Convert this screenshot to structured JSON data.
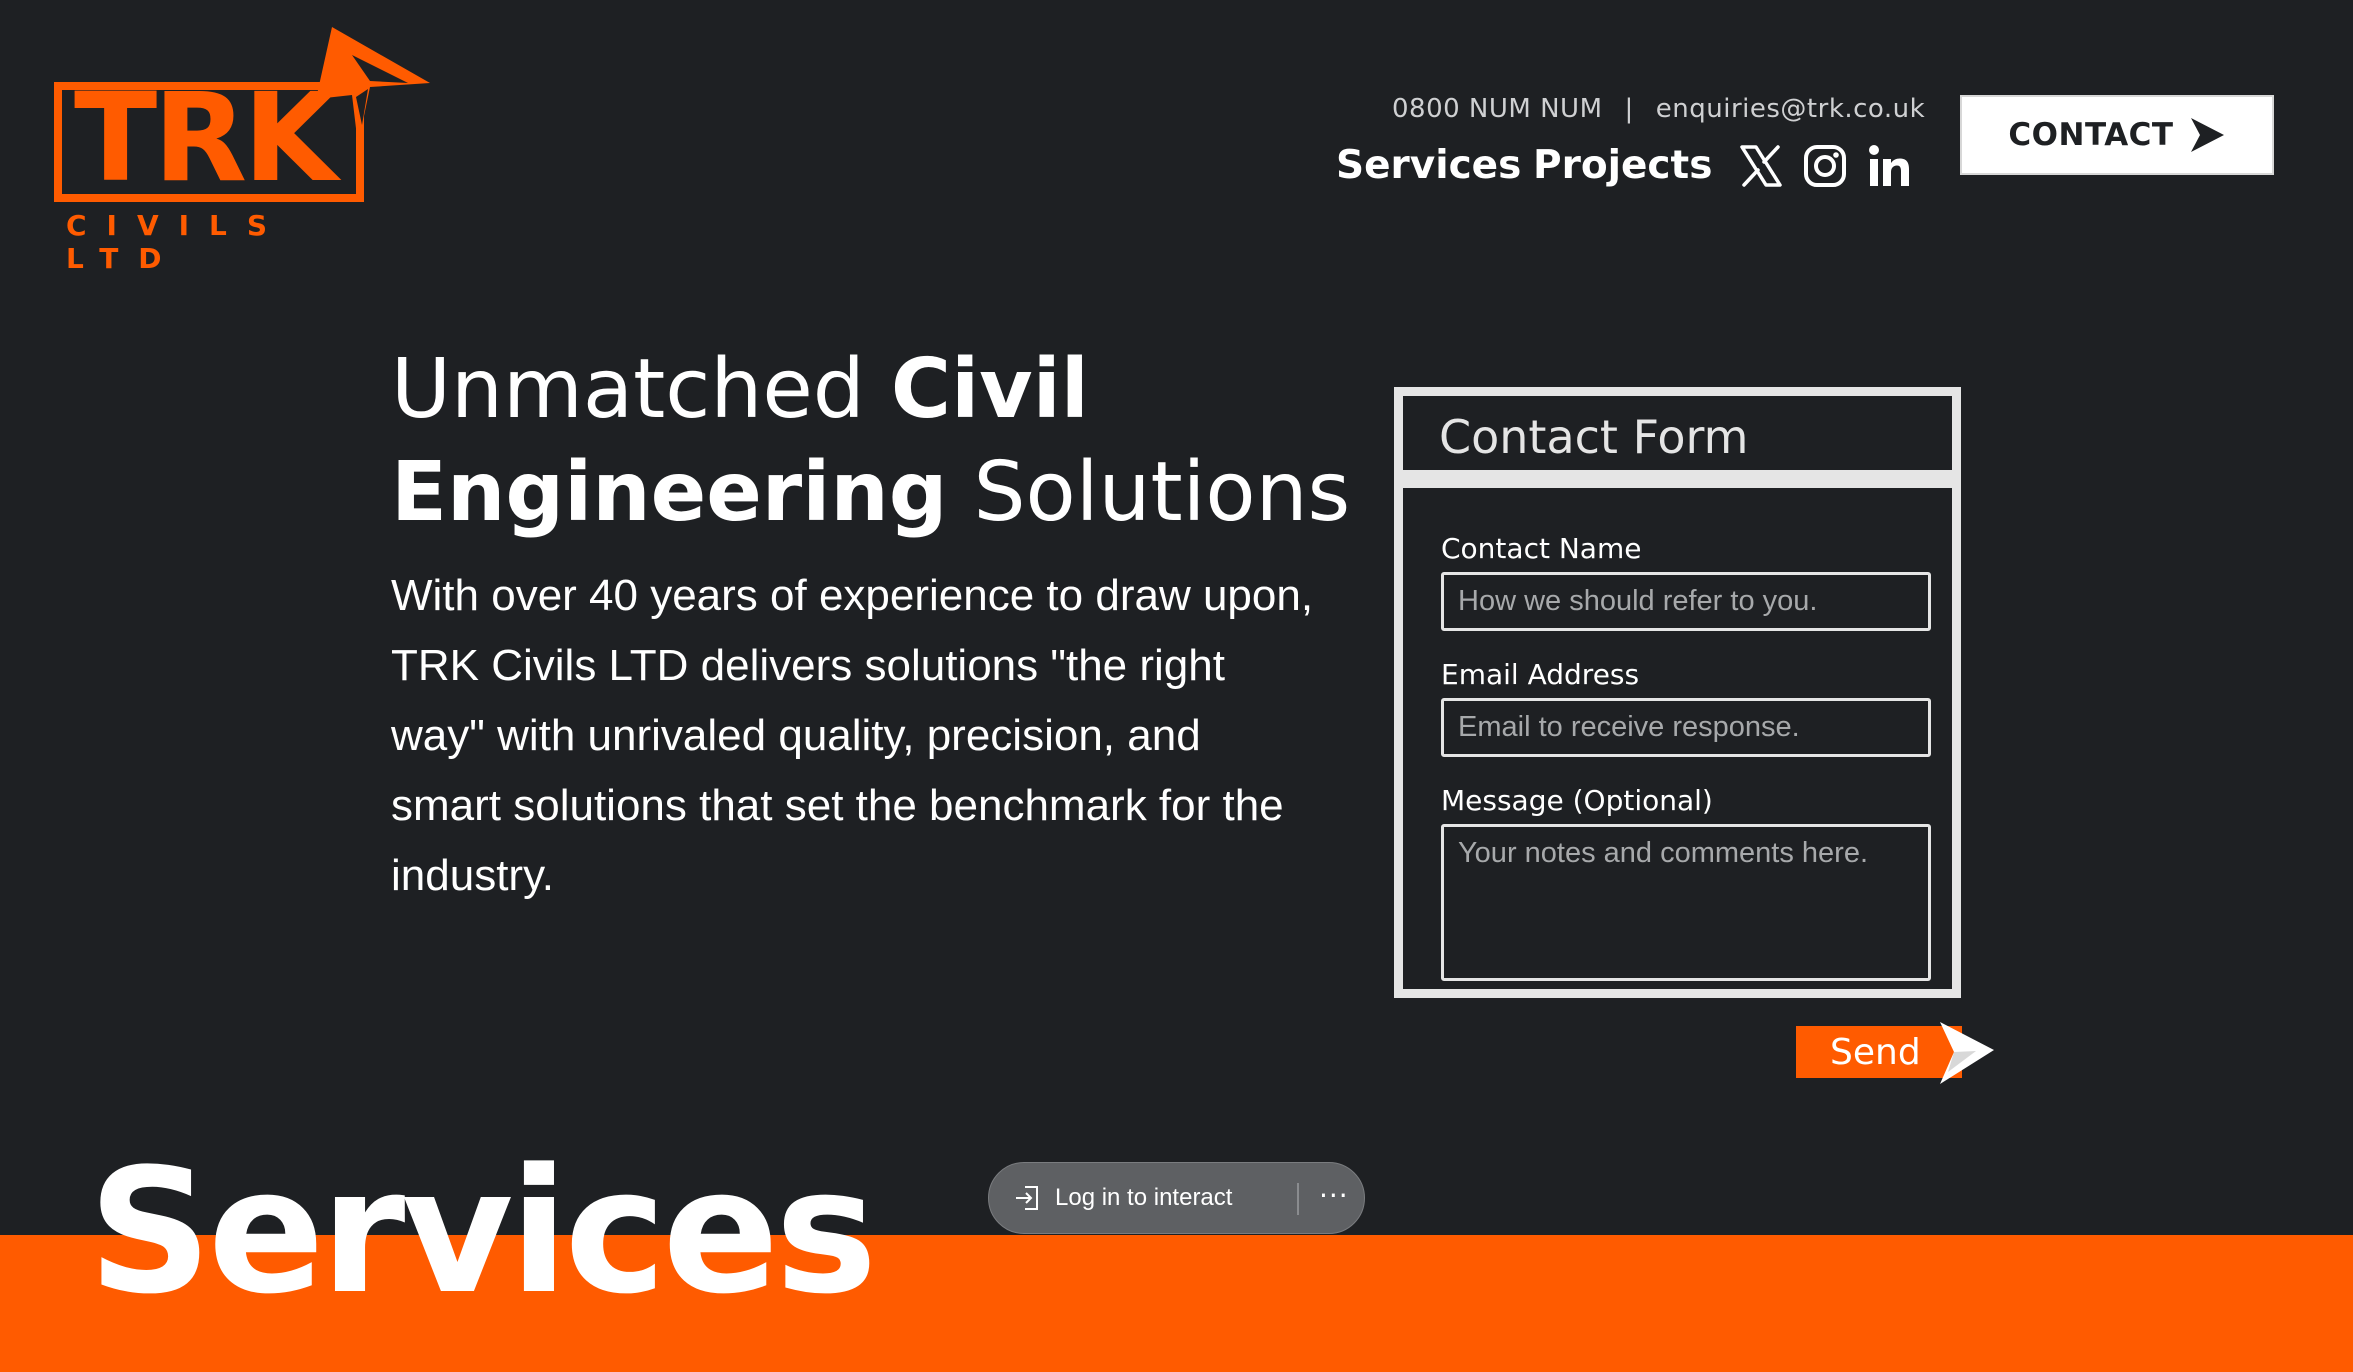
{
  "brand": {
    "logo_text": "TRK",
    "logo_subtitle": "CIVILS LTD",
    "accent_color": "#ff5b00",
    "background_color": "#1e2023"
  },
  "header": {
    "phone": "0800 NUM NUM",
    "separator": "|",
    "email": "enquiries@trk.co.uk",
    "nav": {
      "services": "Services",
      "projects": "Projects"
    },
    "social_icons": [
      "x-icon",
      "instagram-icon",
      "linkedin-icon"
    ],
    "contact_button": "CONTACT"
  },
  "hero": {
    "title_part1": "Unmatched ",
    "title_part2": "Civil",
    "title_part3": "Engineering",
    "title_part4": " Solutions",
    "body": "With over 40 years of experience to draw upon, TRK Civils LTD delivers solutions \"the right way\" with unrivaled quality, precision, and smart solutions that set the benchmark for the industry."
  },
  "contact_form": {
    "title": "Contact Form",
    "name_label": "Contact Name",
    "name_placeholder": "How we should refer to you.",
    "email_label": "Email Address",
    "email_placeholder": "Email to receive response.",
    "message_label": "Message (Optional)",
    "message_placeholder": "Your notes and comments here.",
    "send_button": "Send"
  },
  "services_section": {
    "title": "Services"
  },
  "overlay": {
    "login_label": "Log in to interact",
    "more_label": "···"
  }
}
